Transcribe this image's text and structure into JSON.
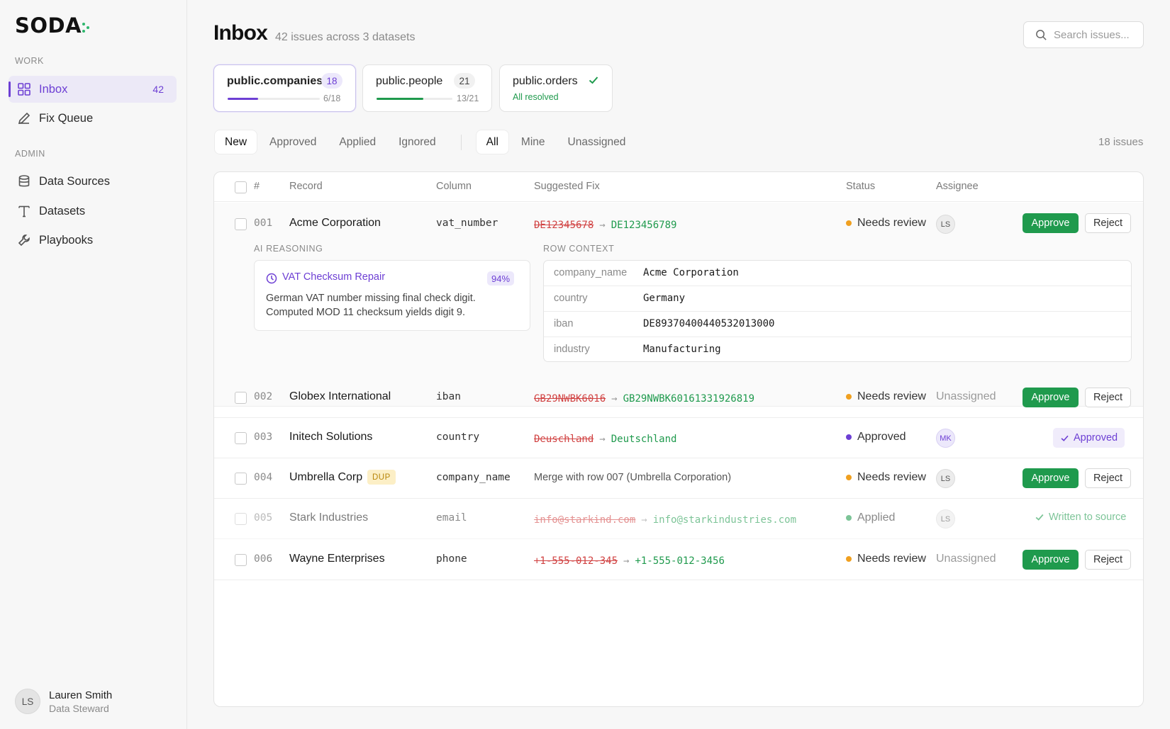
{
  "sidebar": {
    "logo": "SODA",
    "sections": {
      "work": "WORK",
      "admin": "ADMIN"
    },
    "items": [
      {
        "label": "Inbox",
        "badge": "42",
        "icon": "grid-icon"
      },
      {
        "label": "Fix Queue",
        "icon": "pencil-icon"
      },
      {
        "label": "Data Sources",
        "icon": "database-icon"
      },
      {
        "label": "Datasets",
        "icon": "text-icon"
      },
      {
        "label": "Playbooks",
        "icon": "wrench-icon"
      }
    ],
    "user": {
      "initials": "LS",
      "name": "Lauren Smith",
      "role": "Data Steward"
    }
  },
  "header": {
    "title": "Inbox",
    "subtitle": "42 issues across 3 datasets",
    "search_placeholder": "Search issues..."
  },
  "datasets": [
    {
      "name": "public.companies",
      "count": "18",
      "progress_text": "6/18",
      "progress": 0.333,
      "color": "#6d3fd4"
    },
    {
      "name": "public.people",
      "count": "21",
      "progress_text": "13/21",
      "progress": 0.619,
      "color": "#1f9a4d"
    },
    {
      "name": "public.orders",
      "status": "All resolved"
    }
  ],
  "filters": {
    "status_tabs": [
      "New",
      "Approved",
      "Applied",
      "Ignored"
    ],
    "owner_tabs": [
      "All",
      "Mine",
      "Unassigned"
    ],
    "issues_count": "18 issues"
  },
  "table": {
    "headers": {
      "num": "#",
      "record": "Record",
      "column": "Column",
      "fix": "Suggested Fix",
      "status": "Status",
      "assignee": "Assignee"
    },
    "approve_label": "Approve",
    "reject_label": "Reject",
    "rows": [
      {
        "num": "001",
        "record": "Acme Corporation",
        "column": "vat_number",
        "old": "DE12345678",
        "new": "DE123456789",
        "status": "Needs review",
        "assignee": "LS"
      },
      {
        "num": "002",
        "record": "Globex International",
        "column": "iban",
        "old": "GB29NWBK6016",
        "new": "GB29NWBK60161331926819",
        "status": "Needs review",
        "assignee": "Unassigned"
      },
      {
        "num": "003",
        "record": "Initech Solutions",
        "column": "country",
        "old": "Deuschland",
        "new": "Deutschland",
        "status": "Approved",
        "assignee": "MK",
        "action": "Approved"
      },
      {
        "num": "004",
        "record": "Umbrella Corp",
        "tag": "DUP",
        "column": "company_name",
        "fix_text": "Merge with row 007 (Umbrella Corporation)",
        "status": "Needs review",
        "assignee": "LS"
      },
      {
        "num": "005",
        "record": "Stark Industries",
        "column": "email",
        "old": "info@starkind.com",
        "new": "info@starkindustries.com",
        "status": "Applied",
        "assignee": "LS",
        "action": "Written to source"
      },
      {
        "num": "006",
        "record": "Wayne Enterprises",
        "column": "phone",
        "old": "+1-555-012-345",
        "new": "+1-555-012-3456",
        "status": "Needs review",
        "assignee": "Unassigned"
      }
    ],
    "expanded": {
      "reasoning_label": "AI REASONING",
      "context_label": "ROW CONTEXT",
      "playbook": "VAT Checksum Repair",
      "confidence": "94%",
      "reason_line1": "German VAT number missing final check digit.",
      "reason_line2": "Computed MOD 11 checksum yields digit 9.",
      "context": [
        {
          "key": "company_name",
          "value": "Acme Corporation"
        },
        {
          "key": "country",
          "value": "Germany"
        },
        {
          "key": "iban",
          "value": "DE89370400440532013000"
        },
        {
          "key": "industry",
          "value": "Manufacturing"
        }
      ]
    }
  },
  "colors": {
    "accent": "#6d3fd4",
    "success": "#1f9a4d",
    "warning": "#f0a020",
    "danger": "#d14343"
  }
}
